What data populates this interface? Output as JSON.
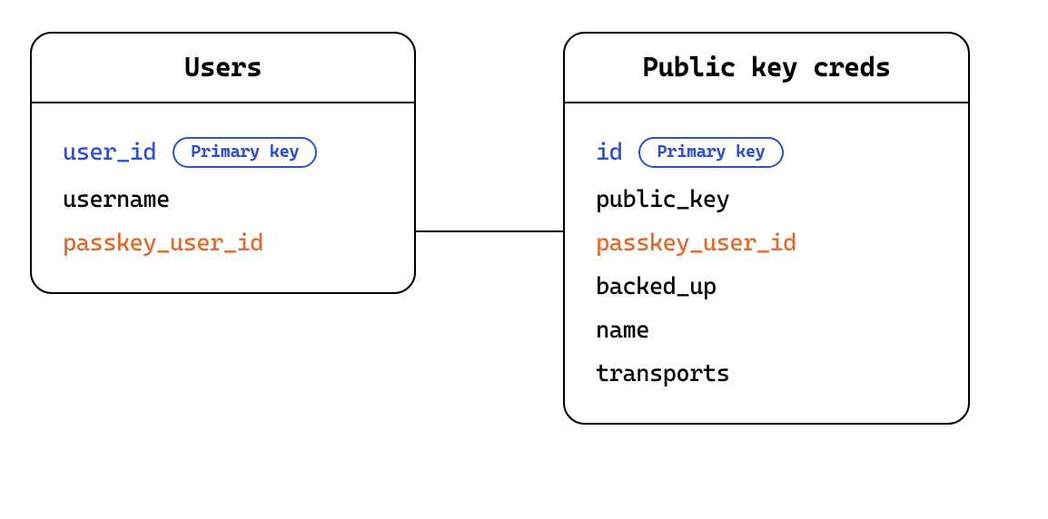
{
  "entities": {
    "users": {
      "title": "Users",
      "fields": [
        {
          "name": "user_id",
          "role": "primary",
          "pk_label": "Primary key"
        },
        {
          "name": "username",
          "role": "normal"
        },
        {
          "name": "passkey_user_id",
          "role": "foreign"
        }
      ]
    },
    "creds": {
      "title": "Public key creds",
      "fields": [
        {
          "name": "id",
          "role": "primary",
          "pk_label": "Primary key"
        },
        {
          "name": "public_key",
          "role": "normal"
        },
        {
          "name": "passkey_user_id",
          "role": "foreign"
        },
        {
          "name": "backed_up",
          "role": "normal"
        },
        {
          "name": "name",
          "role": "normal"
        },
        {
          "name": "transports",
          "role": "normal"
        }
      ]
    }
  },
  "relationship": {
    "from": "users.passkey_user_id",
    "to": "creds.passkey_user_id"
  }
}
